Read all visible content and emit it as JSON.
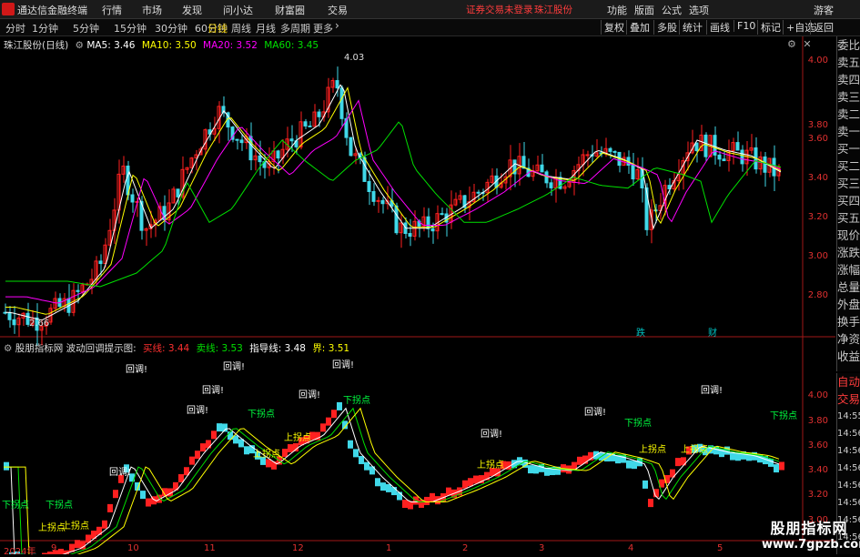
{
  "app_title": "通达信金融终端",
  "menu": [
    "行情",
    "市场",
    "发现",
    "问小达",
    "财富圈",
    "交易"
  ],
  "menu_right": [
    "功能",
    "版面",
    "公式",
    "选项",
    "游客"
  ],
  "login_warning": "证券交易未登录",
  "stock_name": "珠江股份",
  "toolbar": [
    "分时",
    "1分钟",
    "5分钟",
    "15分钟",
    "30分钟",
    "60分钟",
    "日线",
    "周线",
    "月线",
    "多周期",
    "更多"
  ],
  "toolbar_active": "日线",
  "toolbar_right": [
    "复权",
    "叠加",
    "多股",
    "统计",
    "画线",
    "F10",
    "标记",
    "+自选",
    "返回"
  ],
  "main_chart": {
    "title": "珠江股份(日线)",
    "ma": [
      {
        "label": "MA5: 3.46",
        "color": "#ffffff"
      },
      {
        "label": "MA10: 3.50",
        "color": "#ffff00"
      },
      {
        "label": "MA20: 3.52",
        "color": "#ff00ff"
      },
      {
        "label": "MA60: 3.45",
        "color": "#00e000"
      }
    ],
    "y_ticks": [
      "4.00",
      "3.80",
      "3.60",
      "3.40",
      "3.20",
      "3.00",
      "2.80"
    ],
    "high_label": "4.03",
    "low_label": "2.66",
    "markers": [
      "跌",
      "财"
    ]
  },
  "sub_chart": {
    "title": "股朋指标网 波动回调提示图:",
    "items": [
      {
        "label": "买线: 3.44",
        "color": "#ff3030"
      },
      {
        "label": "卖线: 3.53",
        "color": "#00e000"
      },
      {
        "label": "指导线: 3.48",
        "color": "#ffffff"
      },
      {
        "label": "界: 3.51",
        "color": "#ffff00"
      }
    ],
    "y_ticks": [
      "4.00",
      "3.80",
      "3.60",
      "3.40",
      "3.20",
      "3.00"
    ],
    "labels_huitiao": "回调!",
    "labels_down": "下拐点",
    "labels_up": "上拐点"
  },
  "x_labels": [
    "2024年",
    "9",
    "10",
    "11",
    "12",
    "1",
    "2",
    "3",
    "4",
    "5"
  ],
  "side_panel": [
    "委比",
    "卖五",
    "卖四",
    "卖三",
    "卖二",
    "卖一",
    "买一",
    "买二",
    "买三",
    "买四",
    "买五",
    "现价",
    "涨跌",
    "涨幅",
    "总量",
    "外盘",
    "换手",
    "净资",
    "收益",
    "自动",
    "交易"
  ],
  "side_times": [
    "14:55",
    "14:56",
    "14:56",
    "14:56",
    "14:56",
    "14:56",
    "14:56",
    "14:56",
    "14:56",
    "14:56"
  ],
  "watermark": {
    "line1": "股朋指标网",
    "line2": "www.7gpzb.com"
  },
  "colors": {
    "up": "#ff2020",
    "down": "#40d8e8",
    "ma5": "#ffffff",
    "ma10": "#ffff00",
    "ma20": "#ff00ff",
    "ma60": "#00e000",
    "axis": "#e03030"
  }
}
